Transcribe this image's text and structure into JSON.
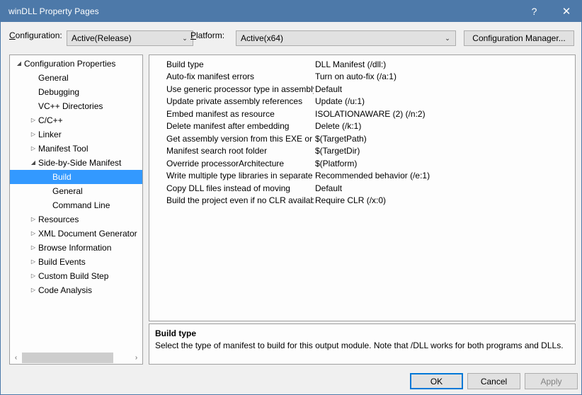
{
  "window": {
    "title": "winDLL Property Pages",
    "titlebar_color": "#4d79a9",
    "help_icon": "?",
    "close_icon": "✕"
  },
  "toolbar": {
    "configuration_label": "Configuration:",
    "configuration_value": "Active(Release)",
    "platform_label": "Platform:",
    "platform_value": "Active(x64)",
    "configuration_manager_label": "Configuration Manager...",
    "dropdown_arrow": "⌄"
  },
  "tree": {
    "selection_color": "#3399ff",
    "expanded_glyph": "◢",
    "collapsed_glyph": "▷",
    "nodes": [
      {
        "label": "Configuration Properties",
        "indent": 0,
        "state": "expanded",
        "selected": false
      },
      {
        "label": "General",
        "indent": 1,
        "state": "leaf",
        "selected": false
      },
      {
        "label": "Debugging",
        "indent": 1,
        "state": "leaf",
        "selected": false
      },
      {
        "label": "VC++ Directories",
        "indent": 1,
        "state": "leaf",
        "selected": false
      },
      {
        "label": "C/C++",
        "indent": 1,
        "state": "collapsed",
        "selected": false
      },
      {
        "label": "Linker",
        "indent": 1,
        "state": "collapsed",
        "selected": false
      },
      {
        "label": "Manifest Tool",
        "indent": 1,
        "state": "collapsed",
        "selected": false
      },
      {
        "label": "Side-by-Side Manifest",
        "indent": 1,
        "state": "expanded",
        "selected": false
      },
      {
        "label": "Build",
        "indent": 2,
        "state": "leaf",
        "selected": true
      },
      {
        "label": "General",
        "indent": 2,
        "state": "leaf",
        "selected": false
      },
      {
        "label": "Command Line",
        "indent": 2,
        "state": "leaf",
        "selected": false
      },
      {
        "label": "Resources",
        "indent": 1,
        "state": "collapsed",
        "selected": false
      },
      {
        "label": "XML Document Generator",
        "indent": 1,
        "state": "collapsed",
        "selected": false
      },
      {
        "label": "Browse Information",
        "indent": 1,
        "state": "collapsed",
        "selected": false
      },
      {
        "label": "Build Events",
        "indent": 1,
        "state": "collapsed",
        "selected": false
      },
      {
        "label": "Custom Build Step",
        "indent": 1,
        "state": "collapsed",
        "selected": false
      },
      {
        "label": "Code Analysis",
        "indent": 1,
        "state": "collapsed",
        "selected": false
      }
    ],
    "scrollbar": {
      "left_arrow": "‹",
      "right_arrow": "›"
    }
  },
  "properties": [
    {
      "name": "Build type",
      "value": "DLL Manifest (/dll:)"
    },
    {
      "name": "Auto-fix manifest errors",
      "value": "Turn on auto-fix (/a:1)"
    },
    {
      "name": "Use generic processor type in assembly ref",
      "value": "Default"
    },
    {
      "name": "Update private assembly references",
      "value": "Update (/u:1)"
    },
    {
      "name": "Embed manifest as resource",
      "value": "ISOLATIONAWARE (2) (/n:2)"
    },
    {
      "name": "Delete manifest after embedding",
      "value": "Delete (/k:1)"
    },
    {
      "name": "Get assembly version from this EXE or DLL",
      "value": "$(TargetPath)"
    },
    {
      "name": "Manifest search root folder",
      "value": "$(TargetDir)"
    },
    {
      "name": "Override processorArchitecture",
      "value": "$(Platform)"
    },
    {
      "name": "Write multiple type libraries in separate file",
      "value": "Recommended behavior (/e:1)"
    },
    {
      "name": "Copy DLL files instead of moving",
      "value": "Default"
    },
    {
      "name": "Build the project even if no CLR available",
      "value": "Require CLR (/x:0)"
    }
  ],
  "description": {
    "title": "Build type",
    "text": "Select the type of manifest to build for this output module. Note that /DLL works for both programs and DLLs."
  },
  "footer": {
    "ok_label": "OK",
    "cancel_label": "Cancel",
    "apply_label": "Apply",
    "apply_enabled": false
  }
}
